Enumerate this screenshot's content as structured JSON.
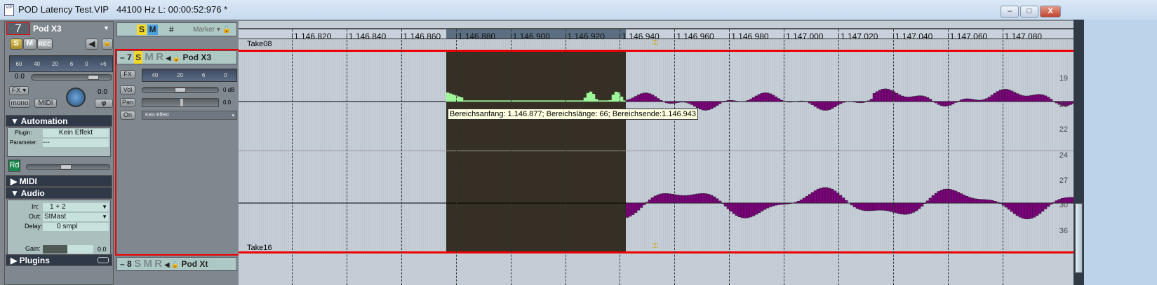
{
  "window": {
    "title": "POD Latency Test.VIP",
    "info": "44100 Hz L: 00:00:52:976 *",
    "buttons": {
      "minimize": "–",
      "maximize": "□",
      "close": "X"
    }
  },
  "inspector": {
    "track_number": "7",
    "track_name": "Pod X3",
    "solo": "S",
    "mute": "M",
    "rec": "REC",
    "meter_scale": [
      "60",
      "40",
      "20",
      "6",
      "0",
      "+6"
    ],
    "volume_value": "0.0",
    "fx_label": "FX",
    "mono_label": "mono",
    "midi_label": "MIDI",
    "pan_value": "0.0",
    "phase_label": "φ",
    "automation": {
      "header": "Automation",
      "plugin_label": "Plugin:",
      "plugin_value": "Kein Effekt",
      "parameter_label": "Parameter:",
      "parameter_value": "---",
      "read_label": "Rd"
    },
    "midi_header": "MIDI",
    "audio": {
      "header": "Audio",
      "in_label": "In:",
      "in_value": "1 + 2",
      "out_label": "Out:",
      "out_value": "StMast",
      "delay_label": "Delay:",
      "delay_value": "0 smpl",
      "gain_label": "Gain:",
      "gain_value": "0.0"
    },
    "plugins_header": "Plugins"
  },
  "marker_bar": {
    "solo": "S",
    "mute": "M",
    "grid": "#",
    "marker_label": "Marker"
  },
  "tracks": [
    {
      "number": "7",
      "solo": "S",
      "mute": "M",
      "rec": "R",
      "name": "Pod X3",
      "fx": "FX",
      "vol": "Vol",
      "vol_value": "0 dB",
      "pan": "Pan",
      "pan_value": "0.0",
      "on": "On",
      "effect": "Kein Effekt",
      "meter_scale": [
        "40",
        "20",
        "6",
        "0"
      ]
    },
    {
      "number": "8",
      "solo": "S",
      "mute": "M",
      "rec": "R",
      "name": "Pod Xt"
    }
  ],
  "ruler": [
    "1.146.820",
    "1.146.840",
    "1.146.860",
    "1.146.880",
    "1.146.900",
    "1.146.920",
    "1.146.940",
    "1.146.960",
    "1.146.980",
    "1.147.000",
    "1.147.020",
    "1.147.040",
    "1.147.060",
    "1.147.080"
  ],
  "takes": {
    "top": "Take08",
    "bottom": "Take16"
  },
  "tooltip": "Bereichsanfang: 1.146.877; Bereichslänge: 66; Bereichsende:1.146.943",
  "scale_labels": [
    "19",
    "21",
    "22",
    "24",
    "27",
    "30",
    "36"
  ],
  "colors": {
    "selection": "#362f25",
    "wave_selected": "#9ef59a",
    "wave": "#800080",
    "track_border": "#e00000"
  }
}
